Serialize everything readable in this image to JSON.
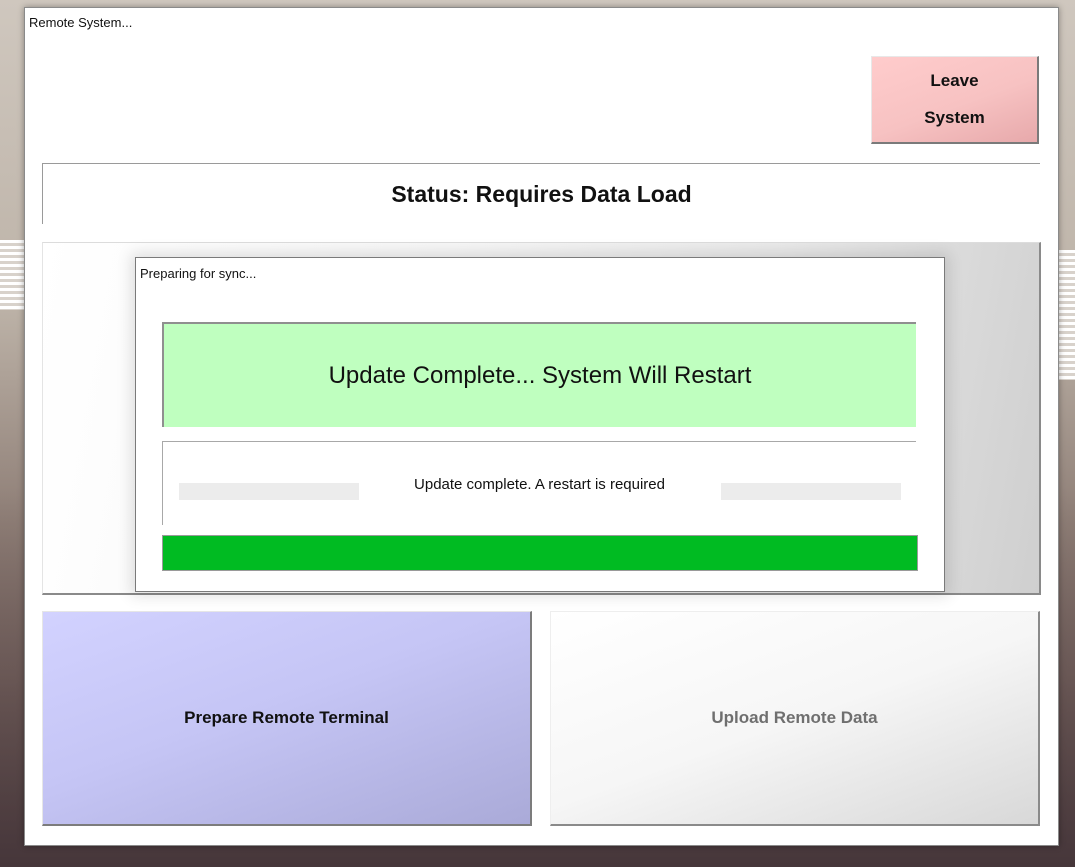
{
  "window": {
    "title": "Remote System..."
  },
  "leave_button": {
    "line1": "Leave",
    "line2": "System",
    "color": "#ffcccc"
  },
  "status": {
    "text": "Status: Requires Data Load"
  },
  "actions": {
    "prepare_label": "Prepare Remote Terminal",
    "upload_label": "Upload Remote Data",
    "prepare_color": "#ccccff",
    "upload_enabled": false
  },
  "dialog": {
    "title": "Preparing for sync...",
    "banner_text": "Update Complete... System Will Restart",
    "banner_color": "#bfffbf",
    "message": "Update complete. A restart is required",
    "progress_fraction": 1.0,
    "progress_color": "#00bb22"
  }
}
